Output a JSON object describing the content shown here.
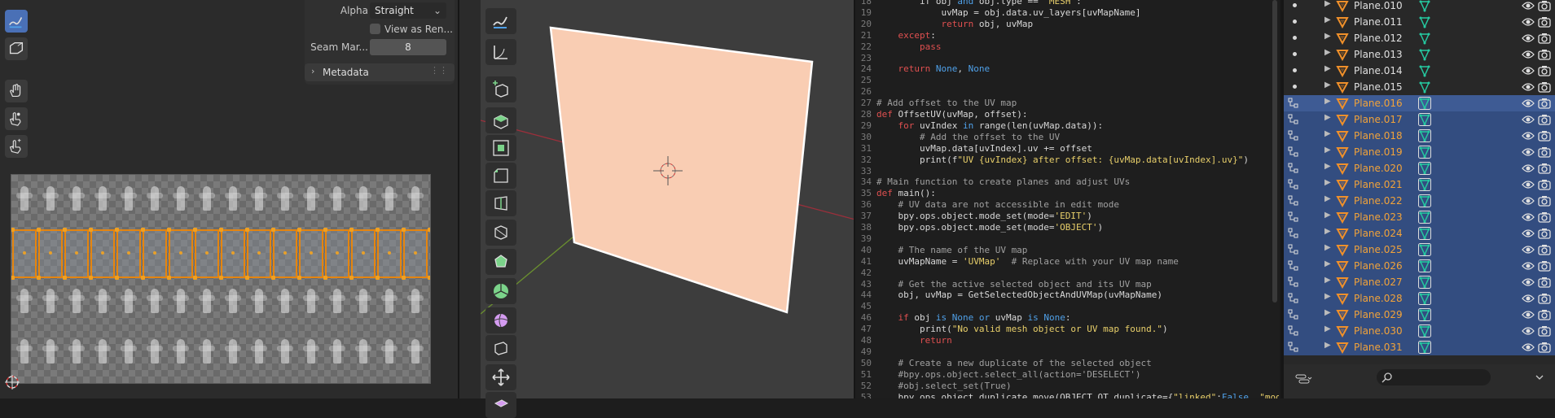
{
  "uv_editor": {
    "props": {
      "alpha_label": "Alpha",
      "alpha_value": "Straight",
      "view_as_render_label": "View as Ren...",
      "seam_margin_label": "Seam Mar...",
      "seam_margin_value": "8"
    },
    "metadata_label": "Metadata",
    "tools": [
      "annotate-icon",
      "annotate-box-icon",
      "grab-hand-icon",
      "pinch-icon",
      "relax-icon"
    ],
    "selected_row_cells": 16,
    "accent": "#e5850f"
  },
  "viewport": {
    "plane_color": "#f9cdb3",
    "x_axis_color": "#9b2f3b",
    "y_axis_color": "#6a8f2f",
    "tools": [
      "annotate-icon",
      "measure-icon",
      "add-cube-icon",
      "extrude-icon",
      "inset-icon",
      "bevel-icon",
      "loop-cut-icon",
      "knife-icon",
      "poly-build-icon",
      "spin-icon",
      "smooth-icon",
      "shear-icon",
      "transform-icon",
      "rip-icon"
    ]
  },
  "text_editor": {
    "lines": [
      {
        "n": "18",
        "segs": [
          {
            "t": "        if obj ",
            "c": "#d8d8d8"
          },
          {
            "t": "and",
            "c": "#4fa0e8"
          },
          {
            "t": " obj.type == ",
            "c": "#d8d8d8"
          },
          {
            "t": "'MESH'",
            "c": "#e8cf6a"
          },
          {
            "t": ":",
            "c": "#d8d8d8"
          }
        ]
      },
      {
        "n": "19",
        "segs": [
          {
            "t": "            uvMap = obj.data.uv_layers[uvMapName]",
            "c": "#d8d8d8"
          }
        ]
      },
      {
        "n": "20",
        "segs": [
          {
            "t": "            ",
            "c": "#d8d8d8"
          },
          {
            "t": "return",
            "c": "#e05050"
          },
          {
            "t": " obj, uvMap",
            "c": "#d8d8d8"
          }
        ]
      },
      {
        "n": "21",
        "segs": [
          {
            "t": "    ",
            "c": "#d8d8d8"
          },
          {
            "t": "except",
            "c": "#e05050"
          },
          {
            "t": ":",
            "c": "#d8d8d8"
          }
        ]
      },
      {
        "n": "22",
        "segs": [
          {
            "t": "        ",
            "c": "#d8d8d8"
          },
          {
            "t": "pass",
            "c": "#e05050"
          }
        ]
      },
      {
        "n": "23",
        "segs": [
          {
            "t": "",
            "c": "#d8d8d8"
          }
        ]
      },
      {
        "n": "24",
        "segs": [
          {
            "t": "    ",
            "c": "#d8d8d8"
          },
          {
            "t": "return",
            "c": "#e05050"
          },
          {
            "t": " ",
            "c": "#d8d8d8"
          },
          {
            "t": "None",
            "c": "#4fa0e8"
          },
          {
            "t": ", ",
            "c": "#d8d8d8"
          },
          {
            "t": "None",
            "c": "#4fa0e8"
          }
        ]
      },
      {
        "n": "25",
        "segs": [
          {
            "t": "",
            "c": "#d8d8d8"
          }
        ]
      },
      {
        "n": "26",
        "segs": [
          {
            "t": "",
            "c": "#d8d8d8"
          }
        ]
      },
      {
        "n": "27",
        "segs": [
          {
            "t": "# Add offset to the UV map",
            "c": "#a0a0a0"
          }
        ]
      },
      {
        "n": "28",
        "segs": [
          {
            "t": "def",
            "c": "#e05050"
          },
          {
            "t": " OffsetUV(uvMap, offset):",
            "c": "#d8d8d8"
          }
        ]
      },
      {
        "n": "29",
        "segs": [
          {
            "t": "    ",
            "c": "#d8d8d8"
          },
          {
            "t": "for",
            "c": "#e05050"
          },
          {
            "t": " uvIndex ",
            "c": "#d8d8d8"
          },
          {
            "t": "in",
            "c": "#4fa0e8"
          },
          {
            "t": " range(len(uvMap.data)):",
            "c": "#d8d8d8"
          }
        ]
      },
      {
        "n": "30",
        "segs": [
          {
            "t": "        # Add the offset to the UV",
            "c": "#a0a0a0"
          }
        ]
      },
      {
        "n": "31",
        "segs": [
          {
            "t": "        uvMap.data[uvIndex].uv += offset",
            "c": "#d8d8d8"
          }
        ]
      },
      {
        "n": "32",
        "segs": [
          {
            "t": "        print(f",
            "c": "#d8d8d8"
          },
          {
            "t": "\"UV {uvIndex} after offset: {uvMap.data[uvIndex].uv}\"",
            "c": "#e8cf6a"
          },
          {
            "t": ")",
            "c": "#d8d8d8"
          }
        ]
      },
      {
        "n": "33",
        "segs": [
          {
            "t": "",
            "c": "#d8d8d8"
          }
        ]
      },
      {
        "n": "34",
        "segs": [
          {
            "t": "# Main function to create planes and adjust UVs",
            "c": "#a0a0a0"
          }
        ]
      },
      {
        "n": "35",
        "segs": [
          {
            "t": "def",
            "c": "#e05050"
          },
          {
            "t": " main():",
            "c": "#d8d8d8"
          }
        ]
      },
      {
        "n": "36",
        "segs": [
          {
            "t": "    # UV data are not accessible in edit mode",
            "c": "#a0a0a0"
          }
        ]
      },
      {
        "n": "37",
        "segs": [
          {
            "t": "    bpy.ops.object.mode_set(mode=",
            "c": "#d8d8d8"
          },
          {
            "t": "'EDIT'",
            "c": "#e8cf6a"
          },
          {
            "t": ")",
            "c": "#d8d8d8"
          }
        ]
      },
      {
        "n": "38",
        "segs": [
          {
            "t": "    bpy.ops.object.mode_set(mode=",
            "c": "#d8d8d8"
          },
          {
            "t": "'OBJECT'",
            "c": "#e8cf6a"
          },
          {
            "t": ")",
            "c": "#d8d8d8"
          }
        ]
      },
      {
        "n": "39",
        "segs": [
          {
            "t": "",
            "c": "#d8d8d8"
          }
        ]
      },
      {
        "n": "40",
        "segs": [
          {
            "t": "    # The name of the UV map",
            "c": "#a0a0a0"
          }
        ]
      },
      {
        "n": "41",
        "segs": [
          {
            "t": "    uvMapName = ",
            "c": "#d8d8d8"
          },
          {
            "t": "'UVMap'",
            "c": "#e8cf6a"
          },
          {
            "t": "  # Replace with your UV map name",
            "c": "#a0a0a0"
          }
        ]
      },
      {
        "n": "42",
        "segs": [
          {
            "t": "",
            "c": "#d8d8d8"
          }
        ]
      },
      {
        "n": "43",
        "segs": [
          {
            "t": "    # Get the active selected object and its UV map",
            "c": "#a0a0a0"
          }
        ]
      },
      {
        "n": "44",
        "segs": [
          {
            "t": "    obj, uvMap = GetSelectedObjectAndUVMap(uvMapName)",
            "c": "#d8d8d8"
          }
        ]
      },
      {
        "n": "45",
        "segs": [
          {
            "t": "",
            "c": "#d8d8d8"
          }
        ]
      },
      {
        "n": "46",
        "segs": [
          {
            "t": "    ",
            "c": "#d8d8d8"
          },
          {
            "t": "if",
            "c": "#e05050"
          },
          {
            "t": " obj ",
            "c": "#d8d8d8"
          },
          {
            "t": "is",
            "c": "#4fa0e8"
          },
          {
            "t": " ",
            "c": "#d8d8d8"
          },
          {
            "t": "None",
            "c": "#4fa0e8"
          },
          {
            "t": " ",
            "c": "#d8d8d8"
          },
          {
            "t": "or",
            "c": "#4fa0e8"
          },
          {
            "t": " uvMap ",
            "c": "#d8d8d8"
          },
          {
            "t": "is",
            "c": "#4fa0e8"
          },
          {
            "t": " ",
            "c": "#d8d8d8"
          },
          {
            "t": "None",
            "c": "#4fa0e8"
          },
          {
            "t": ":",
            "c": "#d8d8d8"
          }
        ]
      },
      {
        "n": "47",
        "segs": [
          {
            "t": "        print(",
            "c": "#d8d8d8"
          },
          {
            "t": "\"No valid mesh object or UV map found.\"",
            "c": "#e8cf6a"
          },
          {
            "t": ")",
            "c": "#d8d8d8"
          }
        ]
      },
      {
        "n": "48",
        "segs": [
          {
            "t": "        ",
            "c": "#d8d8d8"
          },
          {
            "t": "return",
            "c": "#e05050"
          }
        ]
      },
      {
        "n": "49",
        "segs": [
          {
            "t": "",
            "c": "#d8d8d8"
          }
        ]
      },
      {
        "n": "50",
        "segs": [
          {
            "t": "    # Create a new duplicate of the selected object",
            "c": "#a0a0a0"
          }
        ]
      },
      {
        "n": "51",
        "segs": [
          {
            "t": "    #bpy.ops.object.select_all(action='DESELECT')",
            "c": "#a0a0a0"
          }
        ]
      },
      {
        "n": "52",
        "segs": [
          {
            "t": "    #obj.select_set(True)",
            "c": "#a0a0a0"
          }
        ]
      },
      {
        "n": "53",
        "segs": [
          {
            "t": "    bpy.ops.object.duplicate_move(OBJECT_OT_duplicate={",
            "c": "#d8d8d8"
          },
          {
            "t": "\"linked\"",
            "c": "#e8cf6a"
          },
          {
            "t": ":",
            "c": "#d8d8d8"
          },
          {
            "t": "False",
            "c": "#4fa0e8"
          },
          {
            "t": ", ",
            "c": "#d8d8d8"
          },
          {
            "t": "\"mode\"",
            "c": "#e8cf6a"
          },
          {
            "t": ":",
            "c": "#d8d8d8"
          }
        ]
      }
    ]
  },
  "outliner": {
    "rows": [
      {
        "name": "Plane.010",
        "selected": false,
        "active": false
      },
      {
        "name": "Plane.011",
        "selected": false,
        "active": false
      },
      {
        "name": "Plane.012",
        "selected": false,
        "active": false
      },
      {
        "name": "Plane.013",
        "selected": false,
        "active": false
      },
      {
        "name": "Plane.014",
        "selected": false,
        "active": false
      },
      {
        "name": "Plane.015",
        "selected": false,
        "active": false
      },
      {
        "name": "Plane.016",
        "selected": true,
        "active": true
      },
      {
        "name": "Plane.017",
        "selected": true,
        "active": false
      },
      {
        "name": "Plane.018",
        "selected": true,
        "active": false
      },
      {
        "name": "Plane.019",
        "selected": true,
        "active": false
      },
      {
        "name": "Plane.020",
        "selected": true,
        "active": false
      },
      {
        "name": "Plane.021",
        "selected": true,
        "active": false
      },
      {
        "name": "Plane.022",
        "selected": true,
        "active": false
      },
      {
        "name": "Plane.023",
        "selected": true,
        "active": false
      },
      {
        "name": "Plane.024",
        "selected": true,
        "active": false
      },
      {
        "name": "Plane.025",
        "selected": true,
        "active": false
      },
      {
        "name": "Plane.026",
        "selected": true,
        "active": false
      },
      {
        "name": "Plane.027",
        "selected": true,
        "active": false
      },
      {
        "name": "Plane.028",
        "selected": true,
        "active": false
      },
      {
        "name": "Plane.029",
        "selected": true,
        "active": false
      },
      {
        "name": "Plane.030",
        "selected": true,
        "active": false
      },
      {
        "name": "Plane.031",
        "selected": true,
        "active": false
      }
    ],
    "selected_name_color": "#f2a33a",
    "default_name_color": "#e0e0e0",
    "mesh_icon_color": "#25c9a0",
    "object_icon_color": "#f0902a"
  }
}
